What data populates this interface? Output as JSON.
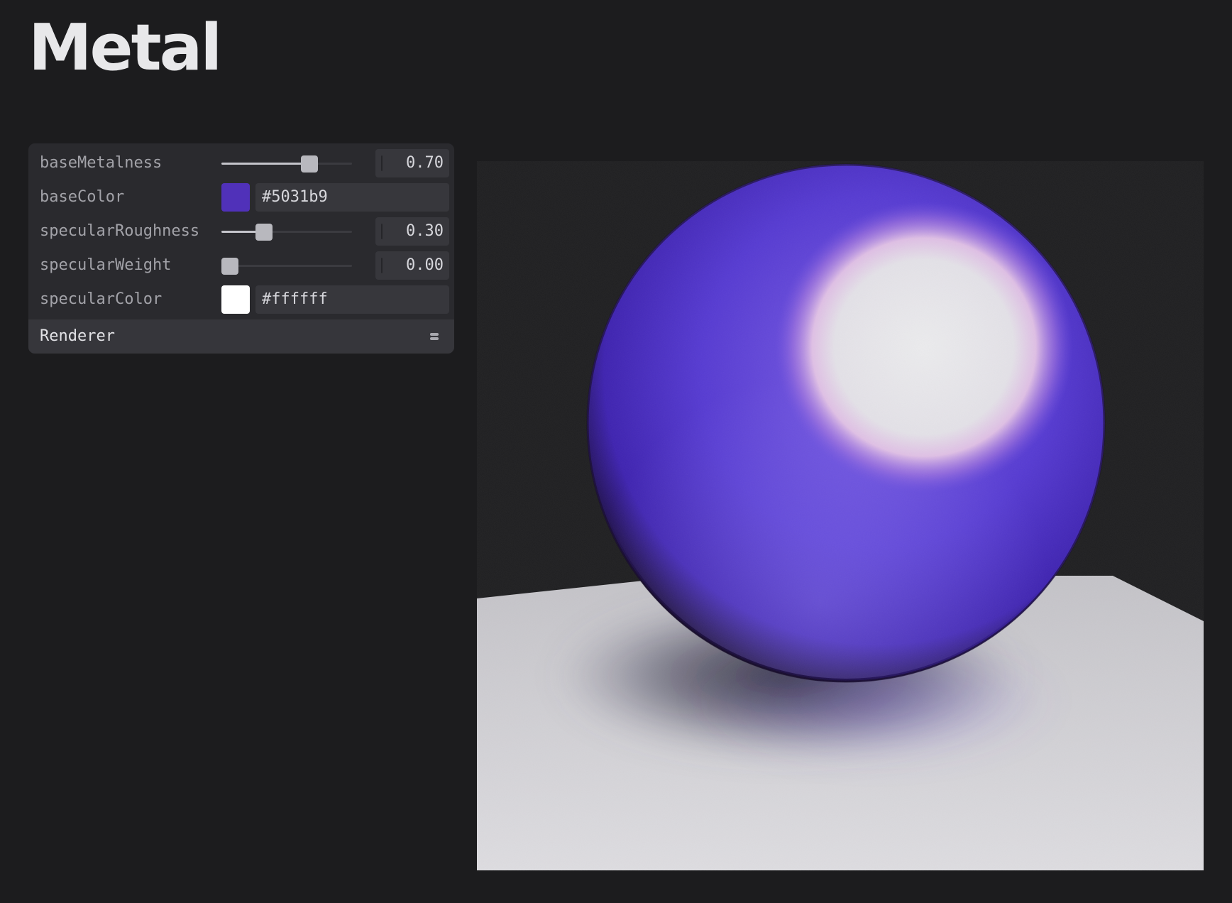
{
  "page": {
    "title": "Metal"
  },
  "panel": {
    "controls": [
      {
        "label": "baseMetalness",
        "type": "slider",
        "value": 0.7,
        "display": "0.70",
        "min": 0,
        "max": 1
      },
      {
        "label": "baseColor",
        "type": "color",
        "color": "#5031b9",
        "display": "#5031b9"
      },
      {
        "label": "specularRoughness",
        "type": "slider",
        "value": 0.3,
        "display": "0.30",
        "min": 0,
        "max": 1
      },
      {
        "label": "specularWeight",
        "type": "slider",
        "value": 0.0,
        "display": "0.00",
        "min": 0,
        "max": 1
      },
      {
        "label": "specularColor",
        "type": "color",
        "color": "#ffffff",
        "display": "#ffffff"
      }
    ],
    "folder": {
      "label": "Renderer",
      "icon": "collapse-icon"
    }
  },
  "viewport": {
    "sphere_color": "#5031b9",
    "highlight_color": "#e6e6e8",
    "floor_color": "#d9d8dc",
    "background": "#1c1c1e"
  }
}
